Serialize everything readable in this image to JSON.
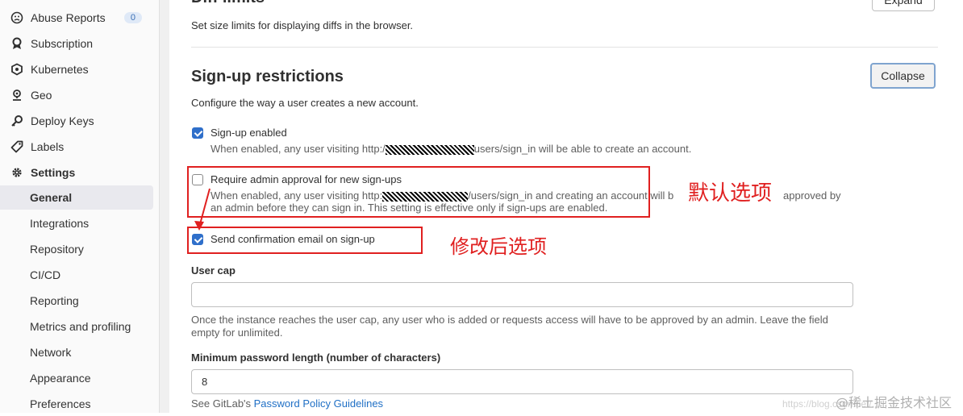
{
  "sidebar": {
    "items": [
      {
        "label": "Abuse Reports",
        "icon": "abuse-reports-icon",
        "badge": "0"
      },
      {
        "label": "Subscription",
        "icon": "subscription-icon"
      },
      {
        "label": "Kubernetes",
        "icon": "kubernetes-icon"
      },
      {
        "label": "Geo",
        "icon": "geo-icon"
      },
      {
        "label": "Deploy Keys",
        "icon": "key-icon"
      },
      {
        "label": "Labels",
        "icon": "label-icon"
      },
      {
        "label": "Settings",
        "icon": "gear-icon"
      }
    ],
    "settings_sub": [
      "General",
      "Integrations",
      "Repository",
      "CI/CD",
      "Reporting",
      "Metrics and profiling",
      "Network",
      "Appearance",
      "Preferences"
    ]
  },
  "diff_limits": {
    "title": "Diff limits",
    "description": "Set size limits for displaying diffs in the browser.",
    "expand_label": "Expand"
  },
  "signup": {
    "title": "Sign-up restrictions",
    "collapse_label": "Collapse",
    "description": "Configure the way a user creates a new account.",
    "signup_enabled": {
      "label": "Sign-up enabled",
      "checked": true,
      "help_before": "When enabled, any user visiting http:/",
      "help_after": "users/sign_in will be able to create an account."
    },
    "admin_approval": {
      "label": "Require admin approval for new sign-ups",
      "checked": false,
      "help_before": "When enabled, any user visiting http:",
      "help_after": "/users/sign_in and creating an account will b",
      "help_tail": "approved by",
      "help_line2": "an admin before they can sign in. This setting is effective only if sign-ups are enabled."
    },
    "confirmation_email": {
      "label": "Send confirmation email on sign-up",
      "checked": true
    },
    "user_cap": {
      "label": "User cap",
      "value": "",
      "help_line1": "Once the instance reaches the user cap, any user who is added or requests access will have to be approved by an admin. Leave the field",
      "help_line2": "empty for unlimited."
    },
    "min_password": {
      "label": "Minimum password length (number of characters)",
      "value": "8",
      "help_prefix": "See GitLab's ",
      "help_link": "Password Policy Guidelines"
    }
  },
  "annotations": {
    "default_option": "默认选项",
    "modified_option": "修改后选项",
    "color": "#e02020"
  },
  "watermark": {
    "text": "@稀土掘金技术社区",
    "url": "https://blog.csdn.net/..."
  }
}
